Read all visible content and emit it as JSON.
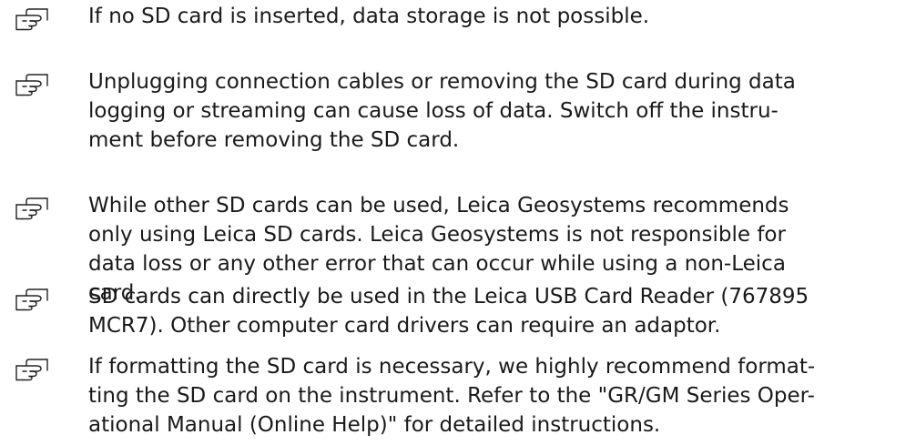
{
  "notes": [
    {
      "icon": "pointing-hand-icon",
      "lines": [
        "If no SD card is inserted, data storage is not possible."
      ]
    },
    {
      "icon": "pointing-hand-icon",
      "lines": [
        "Unplugging connection cables or removing the SD card during data",
        "logging or streaming can cause loss of data. Switch off the instru-",
        "ment before removing the SD card."
      ]
    },
    {
      "icon": "pointing-hand-icon",
      "lines": [
        "While other SD cards can be used, Leica Geosystems recommends",
        "only using Leica SD cards. Leica Geosystems is not responsible for",
        "data loss or any other error that can occur while using a non-Leica",
        "card."
      ]
    },
    {
      "icon": "pointing-hand-icon",
      "lines": [
        "SD cards can directly be used in the Leica USB Card Reader (767895",
        "MCR7). Other computer card drivers can require an adaptor."
      ]
    },
    {
      "icon": "pointing-hand-icon",
      "lines": [
        "If formatting the SD card is necessary, we highly recommend format-",
        "ting the SD card on the instrument. Refer to the \"GR/GM Series Oper-",
        "ational Manual (Online Help)\" for detailed instructions."
      ]
    }
  ]
}
